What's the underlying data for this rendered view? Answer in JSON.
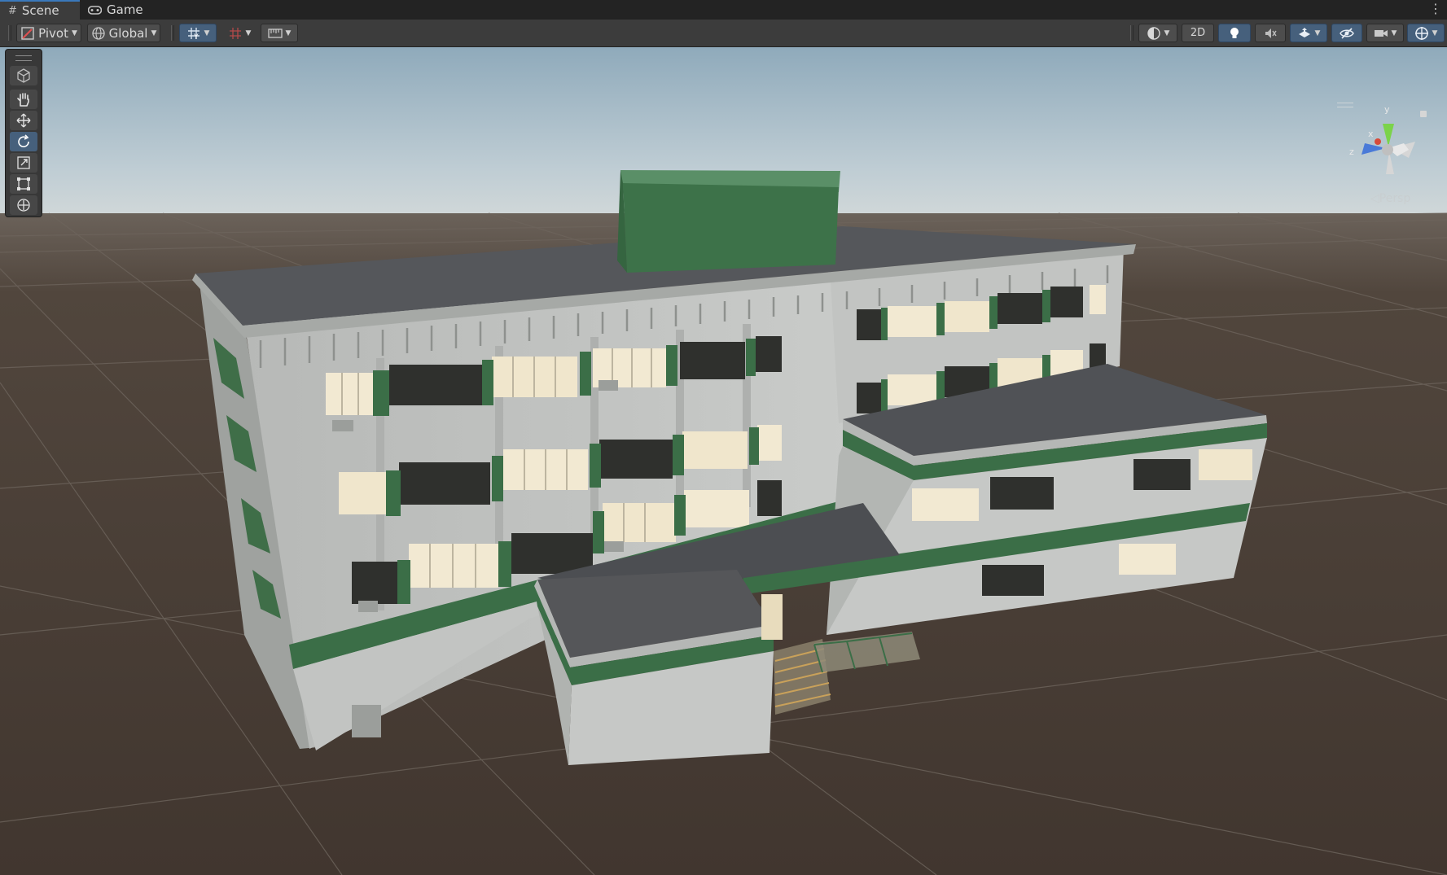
{
  "tabs": [
    {
      "label": "Scene",
      "icon": "grid-hash-icon",
      "active": true
    },
    {
      "label": "Game",
      "icon": "gamepad-icon",
      "active": false
    }
  ],
  "toolbar": {
    "pivot_label": "Pivot",
    "global_label": "Global",
    "two_d_label": "2D"
  },
  "gizmo": {
    "y_label": "y",
    "x_label": "x",
    "z_label": "z",
    "projection_label": "Persp"
  },
  "tools": [
    {
      "name": "view-tool",
      "icon": "cube-icon",
      "active": false
    },
    {
      "name": "hand-tool",
      "icon": "hand-icon",
      "active": false
    },
    {
      "name": "move-tool",
      "icon": "move-arrows-icon",
      "active": false
    },
    {
      "name": "rotate-tool",
      "icon": "rotate-icon",
      "active": true
    },
    {
      "name": "scale-tool",
      "icon": "scale-icon",
      "active": false
    },
    {
      "name": "rect-tool",
      "icon": "rect-transform-icon",
      "active": false
    },
    {
      "name": "transform-tool",
      "icon": "transform-icon",
      "active": false
    }
  ],
  "colors": {
    "accent": "#46607c",
    "building_wall": "#c4c6c4",
    "building_trim": "#3b6e47",
    "roof": "#555659",
    "ground": "#4a3f37",
    "sky": "#a9bcc7"
  }
}
